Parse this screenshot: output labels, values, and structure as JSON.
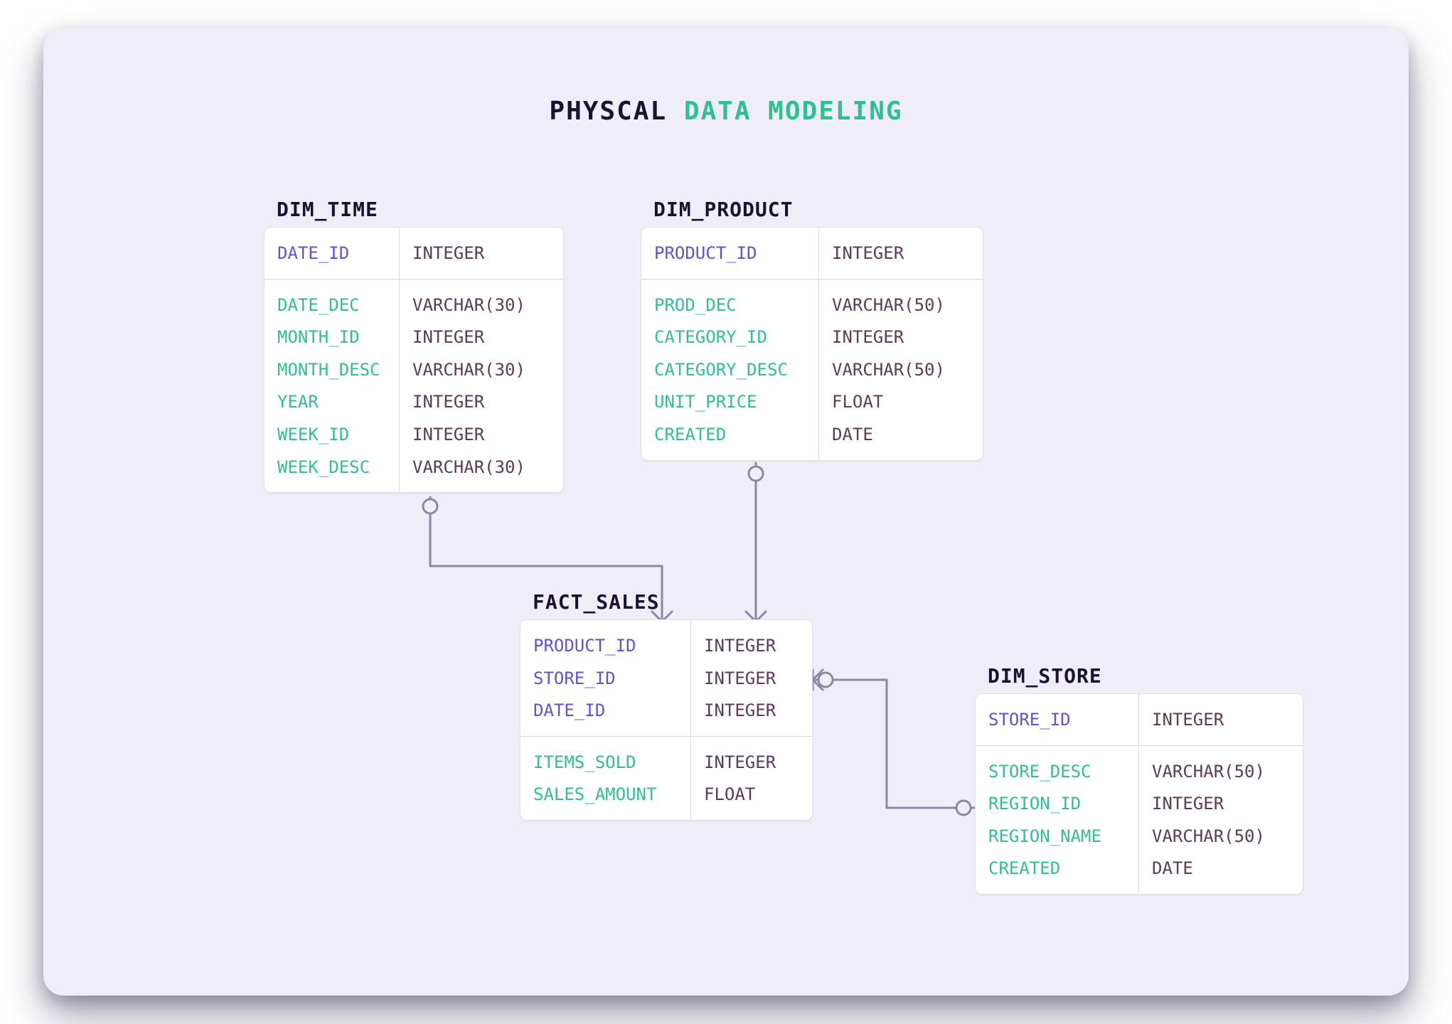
{
  "title": {
    "part1": "PHYSCAL",
    "part2": "DATA MODELING"
  },
  "dim_time": {
    "name": "DIM_TIME",
    "pk": {
      "field": "DATE_ID",
      "type": "INTEGER"
    },
    "cols": [
      {
        "field": "DATE_DEC",
        "type": "VARCHAR(30)"
      },
      {
        "field": "MONTH_ID",
        "type": "INTEGER"
      },
      {
        "field": "MONTH_DESC",
        "type": "VARCHAR(30)"
      },
      {
        "field": "YEAR",
        "type": "INTEGER"
      },
      {
        "field": "WEEK_ID",
        "type": "INTEGER"
      },
      {
        "field": "WEEK_DESC",
        "type": "VARCHAR(30)"
      }
    ]
  },
  "dim_product": {
    "name": "DIM_PRODUCT",
    "pk": {
      "field": "PRODUCT_ID",
      "type": "INTEGER"
    },
    "cols": [
      {
        "field": "PROD_DEC",
        "type": "VARCHAR(50)"
      },
      {
        "field": "CATEGORY_ID",
        "type": "INTEGER"
      },
      {
        "field": "CATEGORY_DESC",
        "type": "VARCHAR(50)"
      },
      {
        "field": "UNIT_PRICE",
        "type": "FLOAT"
      },
      {
        "field": "CREATED",
        "type": "DATE"
      }
    ]
  },
  "fact_sales": {
    "name": "FACT_SALES",
    "fks": [
      {
        "field": "PRODUCT_ID",
        "type": "INTEGER"
      },
      {
        "field": "STORE_ID",
        "type": "INTEGER"
      },
      {
        "field": "DATE_ID",
        "type": "INTEGER"
      }
    ],
    "cols": [
      {
        "field": "ITEMS_SOLD",
        "type": "INTEGER"
      },
      {
        "field": "SALES_AMOUNT",
        "type": "FLOAT"
      }
    ]
  },
  "dim_store": {
    "name": "DIM_STORE",
    "pk": {
      "field": "STORE_ID",
      "type": "INTEGER"
    },
    "cols": [
      {
        "field": "STORE_DESC",
        "type": "VARCHAR(50)"
      },
      {
        "field": "REGION_ID",
        "type": "INTEGER"
      },
      {
        "field": "REGION_NAME",
        "type": "VARCHAR(50)"
      },
      {
        "field": "CREATED",
        "type": "DATE"
      }
    ]
  },
  "colors": {
    "background": "#efedf8",
    "accent_teal": "#2fbf91",
    "pk_purple": "#5b55d6",
    "type_plum": "#5d3a57",
    "connector_gray": "#8d87a0"
  }
}
